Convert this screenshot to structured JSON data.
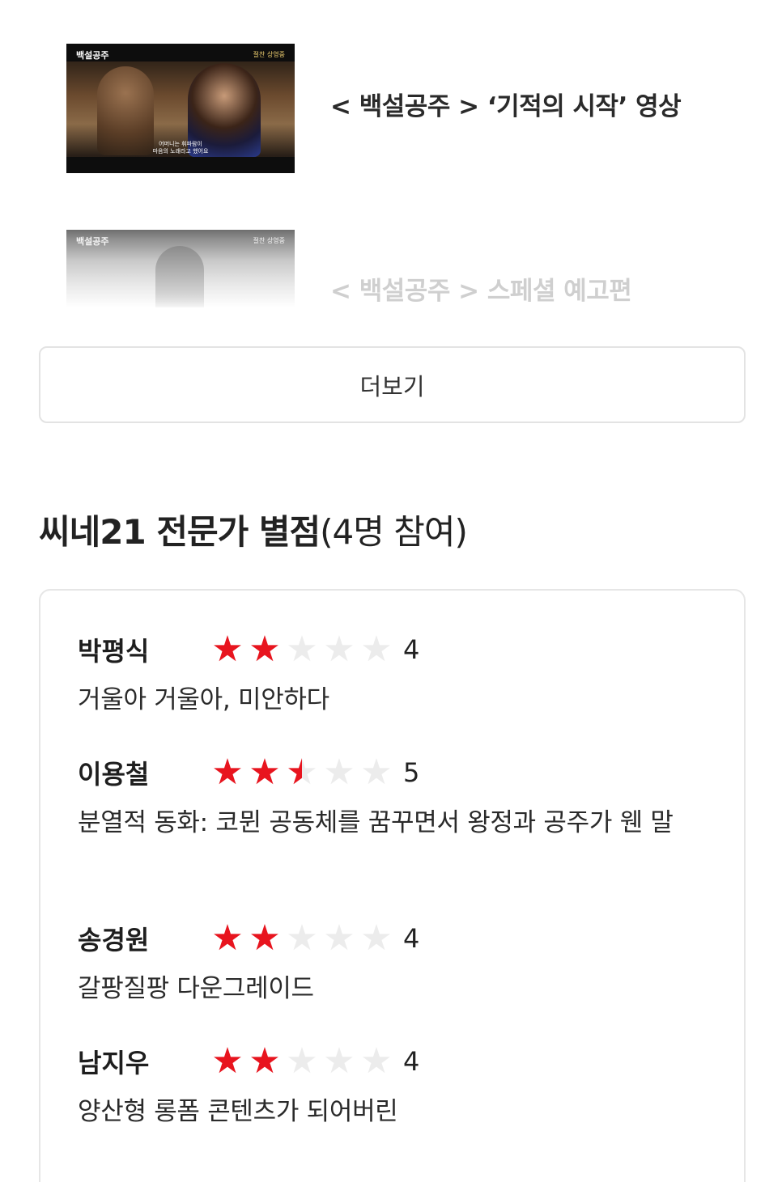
{
  "videos": [
    {
      "title": "< 백설공주 >  ‘기적의 시작’ 영상",
      "thumb_logo": "백설공주",
      "thumb_tag": "절찬 상영중",
      "thumb_subtitle_1": "어머니는 휘파람이",
      "thumb_subtitle_2": "마음의 노래라고 했어요"
    },
    {
      "title": "< 백설공주 >  스페셜 예고편",
      "thumb_logo": "백설공주",
      "thumb_tag": "절찬 상영중"
    }
  ],
  "more_button": "더보기",
  "section": {
    "title_strong": "씨네21 전문가 별점",
    "title_light": "(4명 참여)"
  },
  "star_color": "#e8141e",
  "star_empty_color": "#ececec",
  "reviews": [
    {
      "critic": "박평식",
      "stars_filled": 2,
      "stars_total": 5,
      "score": "4",
      "comment": "거울아 거울아, 미안하다"
    },
    {
      "critic": "이용철",
      "stars_filled": 2.5,
      "stars_total": 5,
      "score": "5",
      "comment": "분열적 동화: 코뮌 공동체를 꿈꾸면서 왕정과 공주가 웬 말"
    },
    {
      "critic": "송경원",
      "stars_filled": 2,
      "stars_total": 5,
      "score": "4",
      "comment": "갈팡질팡 다운그레이드"
    },
    {
      "critic": "남지우",
      "stars_filled": 2,
      "stars_total": 5,
      "score": "4",
      "comment": "양산형 롱폼 콘텐츠가 되어버린"
    }
  ]
}
